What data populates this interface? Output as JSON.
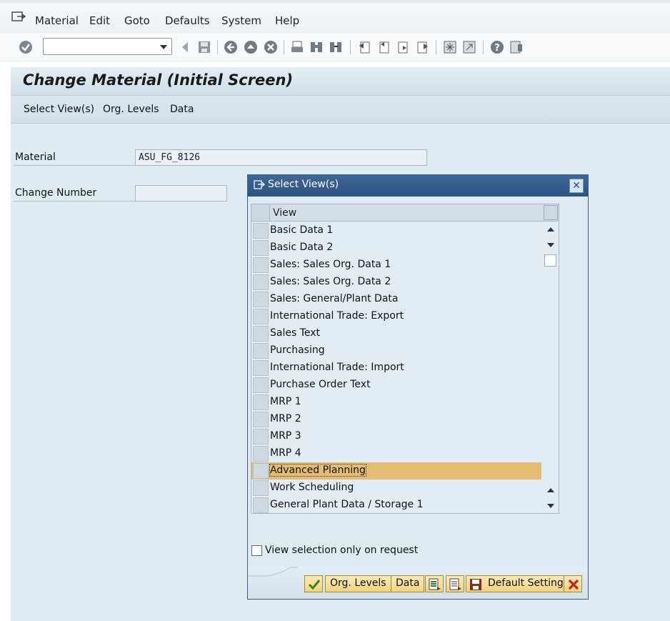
{
  "menubar": {
    "items": [
      "Material",
      "Edit",
      "Goto",
      "Defaults",
      "System",
      "Help"
    ]
  },
  "toolbar": {
    "command_field_value": ""
  },
  "screen": {
    "title": "Change Material (Initial Screen)",
    "app_toolbar": [
      "Select View(s)",
      "Org. Levels",
      "Data"
    ],
    "fields": {
      "material_label": "Material",
      "material_value": "ASU_FG_8126",
      "change_number_label": "Change Number",
      "change_number_value": ""
    }
  },
  "dialog": {
    "title": "Select View(s)",
    "column_header": "View",
    "views": [
      "Basic Data 1",
      "Basic Data 2",
      "Sales: Sales Org. Data 1",
      "Sales: Sales Org. Data 2",
      "Sales: General/Plant Data",
      "International Trade: Export",
      "Sales Text",
      "Purchasing",
      "International Trade: Import",
      "Purchase Order Text",
      "MRP 1",
      "MRP 2",
      "MRP 3",
      "MRP 4",
      "Advanced Planning",
      "Work Scheduling",
      "General Plant Data / Storage 1"
    ],
    "highlighted_view": "Advanced Planning",
    "checkbox_label": "View selection only on request",
    "checkbox_checked": false,
    "buttons": {
      "org_levels": "Org. Levels",
      "data": "Data",
      "default_setting": "Default Setting"
    }
  },
  "colors": {
    "dialog_title_bg": "#2c5382",
    "highlight_row": "#e5bd72",
    "screen_bg": "#dfebf3",
    "button_bg": "#f2d47e"
  }
}
